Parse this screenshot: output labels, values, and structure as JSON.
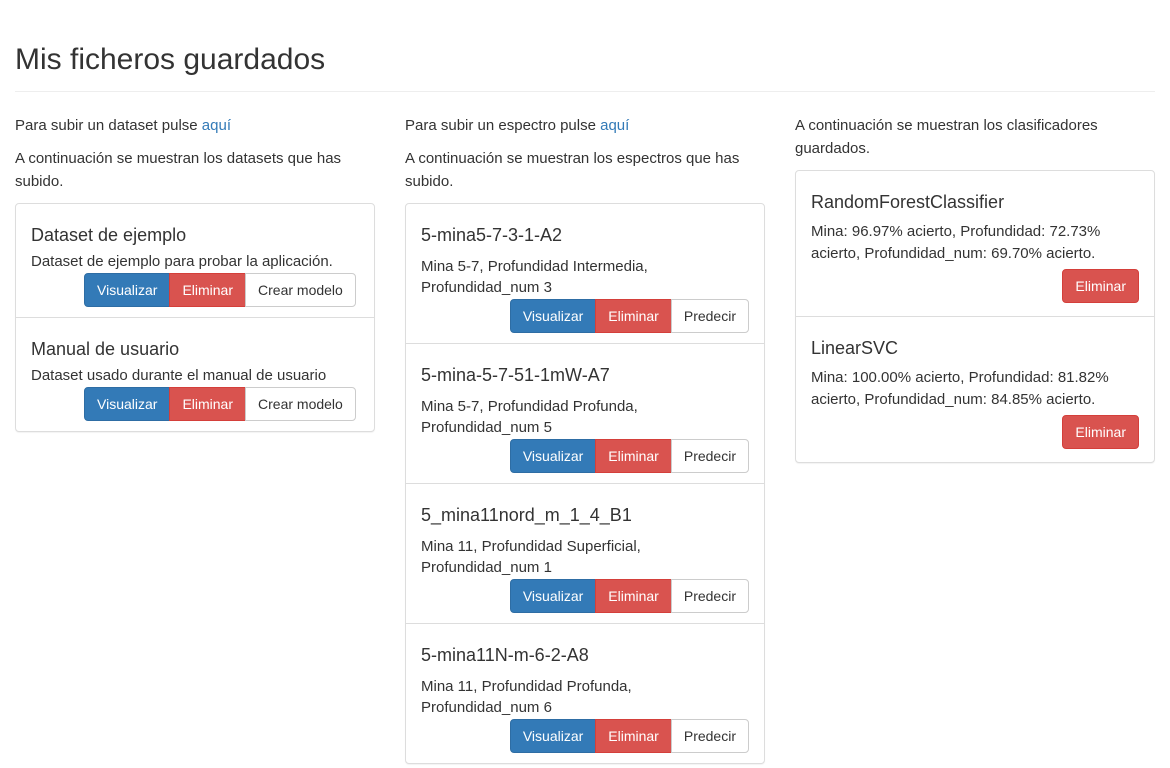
{
  "page": {
    "title": "Mis ficheros guardados"
  },
  "datasets": {
    "upload_text": "Para subir un dataset pulse ",
    "upload_link": "aquí",
    "intro": "A continuación se muestran los datasets que has subido.",
    "items": [
      {
        "title": "Dataset de ejemplo",
        "description": "Dataset de ejemplo para probar la aplicación.",
        "view_label": "Visualizar",
        "delete_label": "Eliminar",
        "model_label": "Crear modelo"
      },
      {
        "title": "Manual de usuario",
        "description": "Dataset usado durante el manual de usuario",
        "view_label": "Visualizar",
        "delete_label": "Eliminar",
        "model_label": "Crear modelo"
      }
    ]
  },
  "spectra": {
    "upload_text": "Para subir un espectro pulse ",
    "upload_link": "aquí",
    "intro": "A continuación se muestran los espectros que has subido.",
    "items": [
      {
        "title": "5-mina5-7-3-1-A2",
        "description": "Mina 5-7, Profundidad Intermedia, Profundidad_num 3",
        "view_label": "Visualizar",
        "delete_label": "Eliminar",
        "predict_label": "Predecir"
      },
      {
        "title": "5-mina-5-7-51-1mW-A7",
        "description": "Mina 5-7, Profundidad Profunda, Profundidad_num 5",
        "view_label": "Visualizar",
        "delete_label": "Eliminar",
        "predict_label": "Predecir"
      },
      {
        "title": "5_mina11nord_m_1_4_B1",
        "description": "Mina 11, Profundidad Superficial, Profundidad_num 1",
        "view_label": "Visualizar",
        "delete_label": "Eliminar",
        "predict_label": "Predecir"
      },
      {
        "title": "5-mina11N-m-6-2-A8",
        "description": "Mina 11, Profundidad Profunda, Profundidad_num 6",
        "view_label": "Visualizar",
        "delete_label": "Eliminar",
        "predict_label": "Predecir"
      }
    ]
  },
  "classifiers": {
    "intro": "A continuación se muestran los clasificadores guardados.",
    "items": [
      {
        "title": "RandomForestClassifier",
        "description": "Mina: 96.97% acierto, Profundidad: 72.73% acierto, Profundidad_num: 69.70% acierto.",
        "delete_label": "Eliminar"
      },
      {
        "title": "LinearSVC",
        "description": "Mina: 100.00% acierto, Profundidad: 81.82% acierto, Profundidad_num: 84.85% acierto.",
        "delete_label": "Eliminar"
      }
    ]
  },
  "colors": {
    "primary": "#337ab7",
    "danger": "#d9534f",
    "default_border": "#cccccc",
    "link": "#337ab7"
  }
}
